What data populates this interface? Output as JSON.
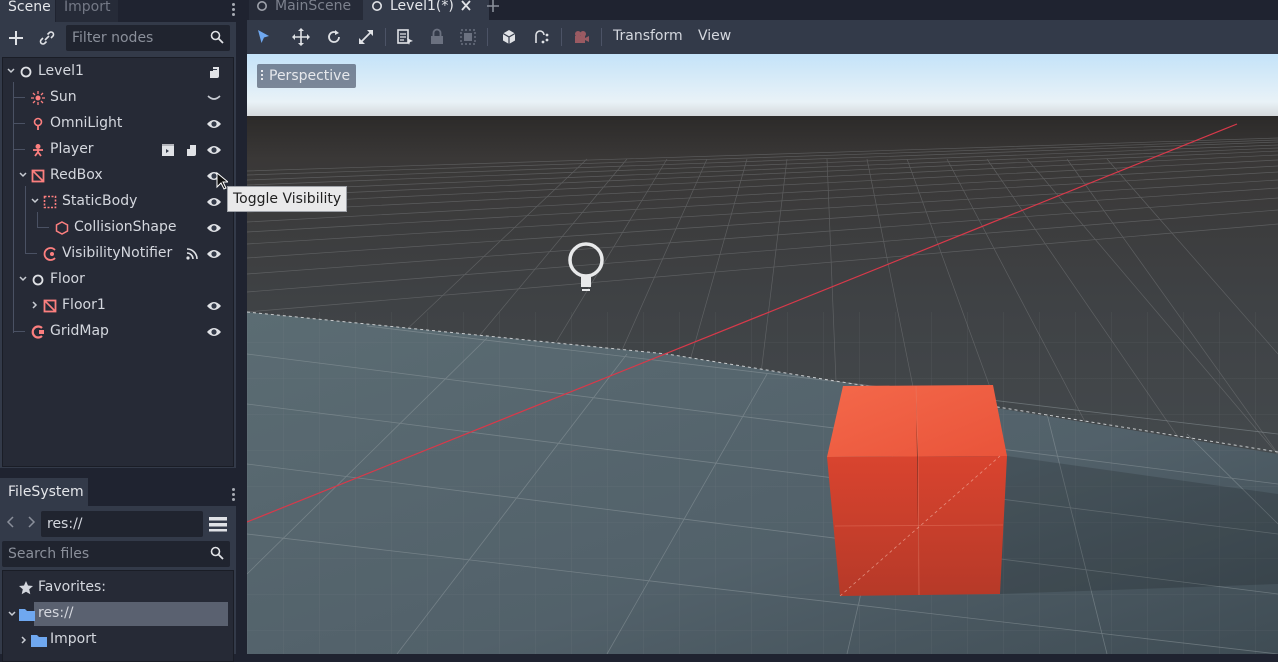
{
  "scene_dock": {
    "tabs": [
      {
        "label": "Scene"
      },
      {
        "label": "Import"
      }
    ],
    "filter_placeholder": "Filter nodes",
    "tree": [
      {
        "label": "Level1",
        "icon": "node3d-icon"
      },
      {
        "label": "Sun",
        "icon": "directional-light-icon"
      },
      {
        "label": "OmniLight",
        "icon": "omni-light-icon"
      },
      {
        "label": "Player",
        "icon": "kinematic-body-icon"
      },
      {
        "label": "RedBox",
        "icon": "mesh-instance-icon"
      },
      {
        "label": "StaticBody",
        "icon": "static-body-icon"
      },
      {
        "label": "CollisionShape",
        "icon": "collision-shape-icon"
      },
      {
        "label": "VisibilityNotifier",
        "icon": "visibility-notifier-icon"
      },
      {
        "label": "Floor",
        "icon": "node3d-icon"
      },
      {
        "label": "Floor1",
        "icon": "mesh-instance-icon"
      },
      {
        "label": "GridMap",
        "icon": "gridmap-icon"
      }
    ]
  },
  "filesystem": {
    "tab_label": "FileSystem",
    "path": "res://",
    "search_placeholder": "Search files",
    "favorites_label": "Favorites:",
    "items": [
      {
        "label": "res://"
      },
      {
        "label": "Import"
      }
    ]
  },
  "scene_tabs": [
    {
      "label": "MainScene"
    },
    {
      "label": "Level1(*)"
    }
  ],
  "toolbar": {
    "transform_menu": "Transform",
    "view_menu": "View"
  },
  "viewport": {
    "perspective_label": "Perspective"
  },
  "tooltip": {
    "text": "Toggle Visibility"
  },
  "colors": {
    "accent": "#6fa8f0",
    "node_3d": "#fc7f7f",
    "panel": "#333a49",
    "background": "#1f2330"
  }
}
